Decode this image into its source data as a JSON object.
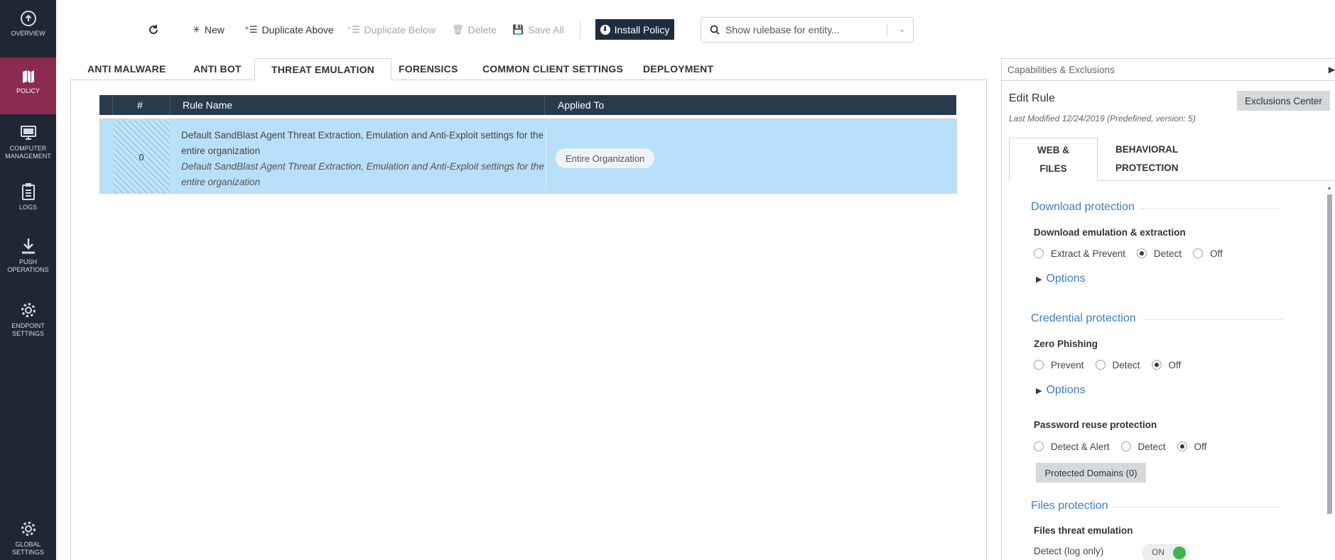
{
  "sidebar": {
    "items": [
      {
        "label": "OVERVIEW",
        "icon": "overview-icon"
      },
      {
        "label": "POLICY",
        "icon": "policy-icon"
      },
      {
        "label": "COMPUTER MANAGEMENT",
        "icon": "computer-icon"
      },
      {
        "label": "LOGS",
        "icon": "logs-icon"
      },
      {
        "label": "PUSH OPERATIONS",
        "icon": "download-icon"
      },
      {
        "label": "ENDPOINT SETTINGS",
        "icon": "gear-icon"
      },
      {
        "label": "GLOBAL SETTINGS",
        "icon": "gear-icon"
      }
    ],
    "active": "POLICY"
  },
  "toolbar": {
    "new_label": "New",
    "dup_above_label": "Duplicate Above",
    "dup_below_label": "Duplicate Below",
    "delete_label": "Delete",
    "save_all_label": "Save All",
    "install_label": "Install Policy",
    "search_placeholder": "Show rulebase for entity..."
  },
  "tabs": [
    {
      "label": "ANTI MALWARE"
    },
    {
      "label": "ANTI BOT"
    },
    {
      "label": "THREAT EMULATION"
    },
    {
      "label": "FORENSICS"
    },
    {
      "label": "COMMON CLIENT SETTINGS"
    },
    {
      "label": "DEPLOYMENT"
    }
  ],
  "active_tab": "THREAT EMULATION",
  "table": {
    "headers": {
      "num": "#",
      "rule_name": "Rule Name",
      "applied_to": "Applied To"
    },
    "rows": [
      {
        "num": "0",
        "name": "Default SandBlast Agent Threat Extraction, Emulation and Anti-Exploit settings for the entire organization",
        "comment": "Default SandBlast Agent Threat Extraction, Emulation and Anti-Exploit settings for the entire organization",
        "applied_to": "Entire Organization"
      }
    ]
  },
  "right_panel": {
    "header": "Capabilities & Exclusions",
    "title": "Edit Rule",
    "last_modified": "Last Modified 12/24/2019 (Predefined, version: 5)",
    "exclusions_label": "Exclusions Center",
    "tabs": [
      {
        "line1": "WEB &",
        "line2": "FILES"
      },
      {
        "line1": "BEHAVIORAL",
        "line2": "PROTECTION"
      }
    ],
    "sections": {
      "download": {
        "title": "Download protection",
        "item_title": "Download emulation & extraction",
        "options": [
          "Extract & Prevent",
          "Detect",
          "Off"
        ],
        "selected": "Detect",
        "options_link": "Options"
      },
      "credential": {
        "title": "Credential protection",
        "item_title": "Zero Phishing",
        "options": [
          "Prevent",
          "Detect",
          "Off"
        ],
        "selected": "Off",
        "options_link": "Options",
        "password_title": "Password reuse protection",
        "password_options": [
          "Detect & Alert",
          "Detect",
          "Off"
        ],
        "password_selected": "Off",
        "domains_label": "Protected Domains (0)"
      },
      "files": {
        "title": "Files protection",
        "item_title": "Files threat emulation",
        "detect_label": "Detect (log only)",
        "toggle_label": "ON",
        "toggle_on": true
      }
    }
  }
}
